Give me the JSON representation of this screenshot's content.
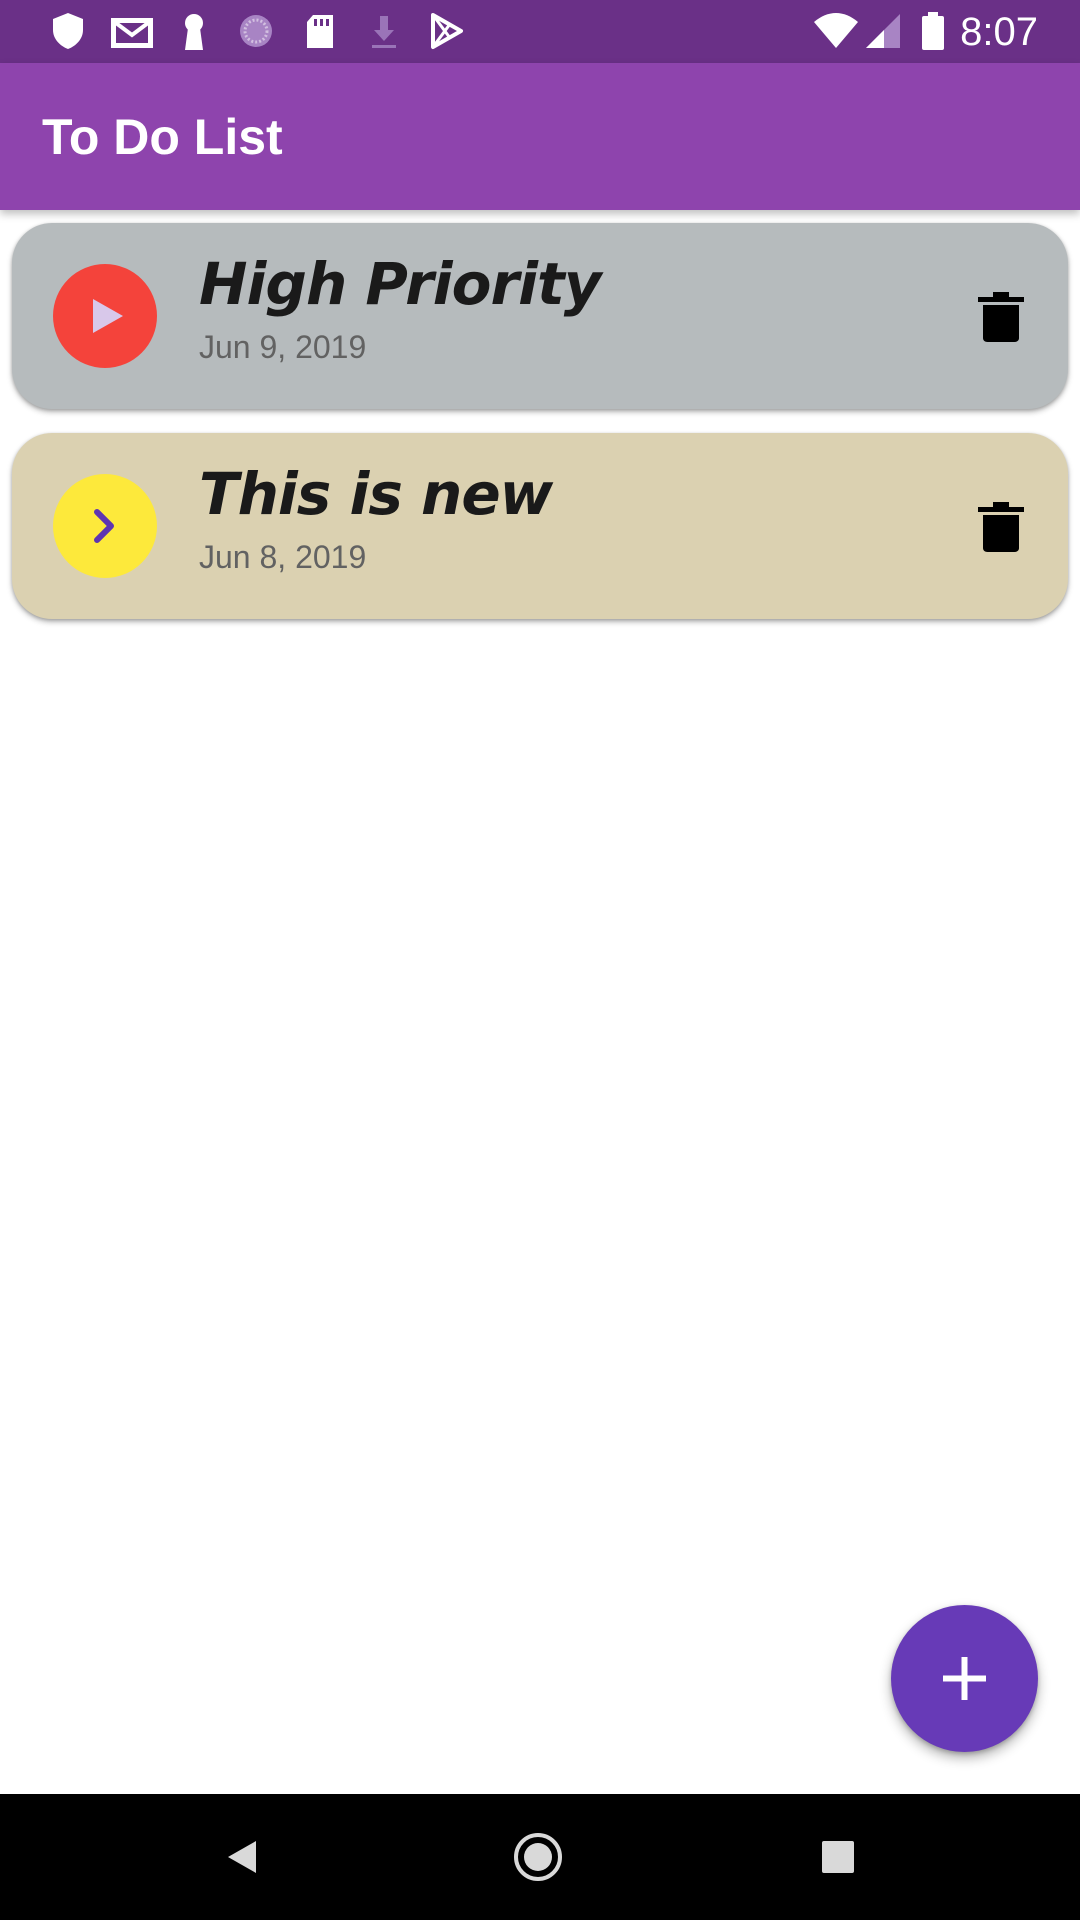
{
  "status_bar": {
    "time": "8:07",
    "left_icons": [
      "shield-icon",
      "gmail-icon",
      "keyhole-icon",
      "sync-icon",
      "sd-card-icon",
      "download-icon",
      "play-store-icon"
    ],
    "right_icons": [
      "wifi-icon",
      "cell-signal-icon",
      "battery-icon"
    ],
    "background_color": "#6a3087"
  },
  "app_bar": {
    "title": "To Do List",
    "background_color": "#8e44ad"
  },
  "todo_items": [
    {
      "title": "High Priority",
      "date": "Jun 9, 2019",
      "card_color": "#b6bbbd",
      "badge_color": "#f4433b",
      "badge_icon": "play-icon",
      "badge_icon_color": "#d8c8ea",
      "action_icon": "trash-icon"
    },
    {
      "title": "This is new",
      "date": "Jun 8, 2019",
      "card_color": "#dbd1b1",
      "badge_color": "#fde93b",
      "badge_icon": "chevron-right-icon",
      "badge_icon_color": "#5e35b1",
      "action_icon": "trash-icon"
    }
  ],
  "fab": {
    "icon": "plus-icon",
    "background_color": "#673ab7"
  },
  "nav_bar": {
    "buttons": [
      "back-icon",
      "home-icon",
      "recents-icon"
    ]
  }
}
